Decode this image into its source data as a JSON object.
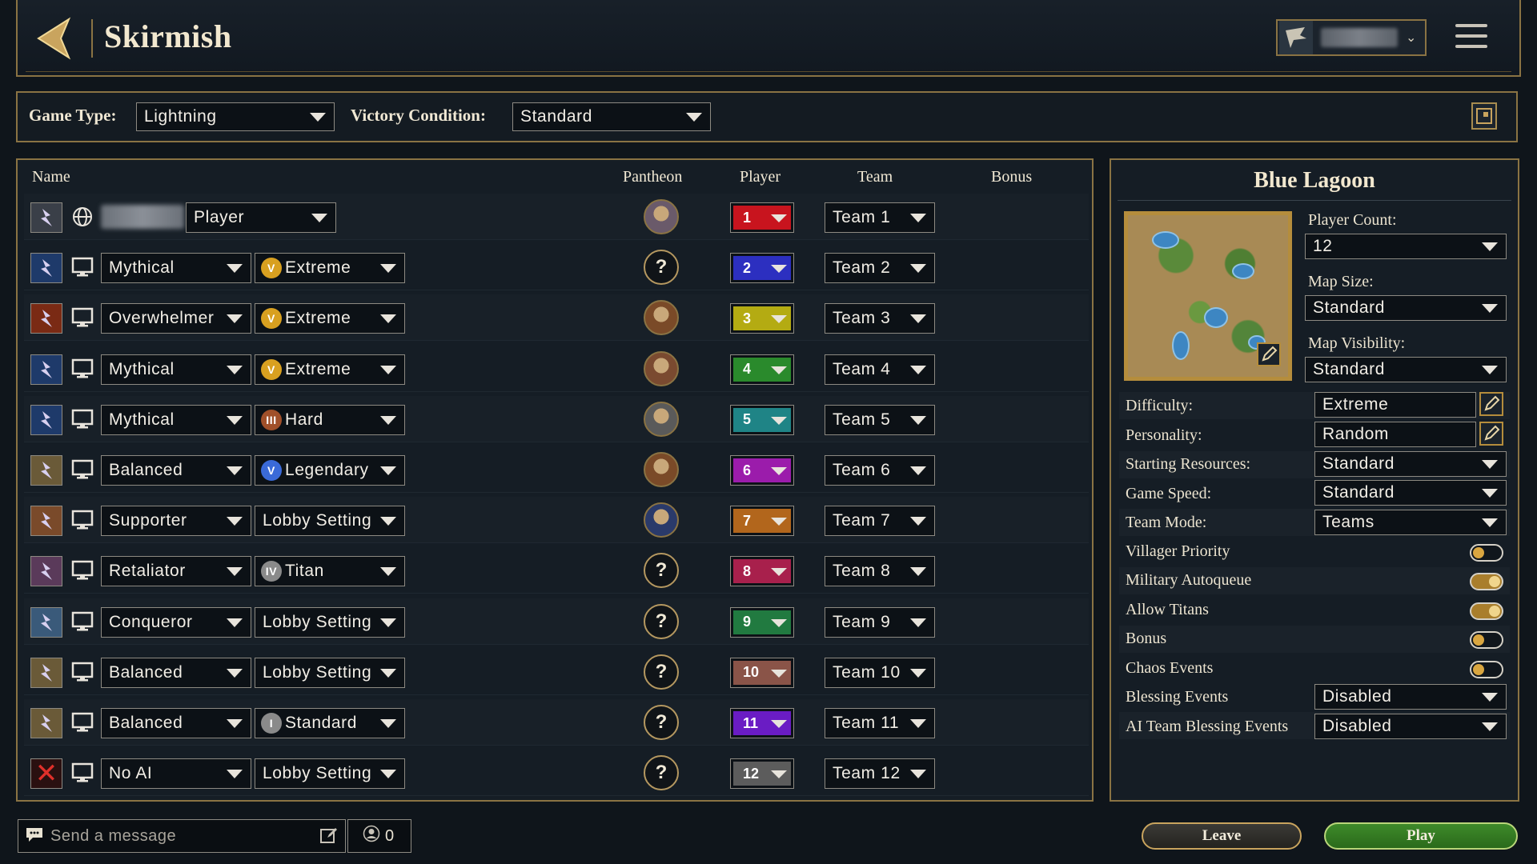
{
  "header": {
    "title": "Skirmish",
    "profile_name": ""
  },
  "filters": {
    "game_type_label": "Game Type:",
    "game_type_value": "Lightning",
    "victory_label": "Victory Condition:",
    "victory_value": "Standard"
  },
  "columns": {
    "name": "Name",
    "pantheon": "Pantheon",
    "player": "Player",
    "team": "Team",
    "bonus": "Bonus"
  },
  "players": [
    {
      "portrait": "human-player-avatar",
      "type_icon": "globe-icon",
      "ai": "Player",
      "difficulty": "",
      "diff_icon": "",
      "pantheon": "known",
      "player_num": "1",
      "color": "#c8141e",
      "team": "Team 1"
    },
    {
      "portrait": "lightning-god-portrait",
      "type_icon": "computer-icon",
      "ai": "Mythical",
      "difficulty": "Extreme",
      "diff_icon": "V",
      "pantheon": "unknown",
      "player_num": "2",
      "color": "#2c2fc0",
      "team": "Team 2"
    },
    {
      "portrait": "fire-warrior-portrait",
      "type_icon": "computer-icon",
      "ai": "Overwhelmer",
      "difficulty": "Extreme",
      "diff_icon": "V",
      "pantheon": "known",
      "player_num": "3",
      "color": "#b4ab12",
      "team": "Team 3"
    },
    {
      "portrait": "lightning-god-portrait",
      "type_icon": "computer-icon",
      "ai": "Mythical",
      "difficulty": "Extreme",
      "diff_icon": "V",
      "pantheon": "known",
      "player_num": "4",
      "color": "#2a8a2c",
      "team": "Team 4"
    },
    {
      "portrait": "lightning-god-portrait",
      "type_icon": "computer-icon",
      "ai": "Mythical",
      "difficulty": "Hard",
      "diff_icon": "III",
      "pantheon": "known",
      "player_num": "5",
      "color": "#1f8486",
      "team": "Team 5"
    },
    {
      "portrait": "scholar-portrait",
      "type_icon": "computer-icon",
      "ai": "Balanced",
      "difficulty": "Legendary",
      "diff_icon": "V",
      "pantheon": "known",
      "player_num": "6",
      "color": "#9b1cab",
      "team": "Team 6"
    },
    {
      "portrait": "handshake-portrait",
      "type_icon": "computer-icon",
      "ai": "Supporter",
      "difficulty": "Lobby Setting",
      "diff_icon": "",
      "pantheon": "known",
      "player_num": "7",
      "color": "#b2661c",
      "team": "Team 7"
    },
    {
      "portrait": "retaliator-portrait",
      "type_icon": "computer-icon",
      "ai": "Retaliator",
      "difficulty": "Titan",
      "diff_icon": "IV",
      "pantheon": "unknown",
      "player_num": "8",
      "color": "#a8204c",
      "team": "Team 8"
    },
    {
      "portrait": "conqueror-portrait",
      "type_icon": "computer-icon",
      "ai": "Conqueror",
      "difficulty": "Lobby Setting",
      "diff_icon": "",
      "pantheon": "unknown",
      "player_num": "9",
      "color": "#217a40",
      "team": "Team 9"
    },
    {
      "portrait": "scholar-portrait",
      "type_icon": "computer-icon",
      "ai": "Balanced",
      "difficulty": "Lobby Setting",
      "diff_icon": "",
      "pantheon": "unknown",
      "player_num": "10",
      "color": "#8a5448",
      "team": "Team 10"
    },
    {
      "portrait": "scholar-portrait",
      "type_icon": "computer-icon",
      "ai": "Balanced",
      "difficulty": "Standard",
      "diff_icon": "I",
      "pantheon": "unknown",
      "player_num": "11",
      "color": "#6a1cc4",
      "team": "Team 11"
    },
    {
      "portrait": "no-ai-x-icon",
      "type_icon": "computer-icon",
      "ai": "No AI",
      "difficulty": "Lobby Setting",
      "diff_icon": "",
      "pantheon": "unknown",
      "player_num": "12",
      "color": "#5c5c5c",
      "team": "Team 12"
    }
  ],
  "map": {
    "name": "Blue Lagoon",
    "player_count_label": "Player Count:",
    "player_count": "12",
    "map_size_label": "Map Size:",
    "map_size": "Standard",
    "visibility_label": "Map Visibility:",
    "visibility": "Standard"
  },
  "settings": {
    "difficulty_label": "Difficulty:",
    "difficulty": "Extreme",
    "personality_label": "Personality:",
    "personality": "Random",
    "resources_label": "Starting Resources:",
    "resources": "Standard",
    "speed_label": "Game Speed:",
    "speed": "Standard",
    "team_mode_label": "Team Mode:",
    "team_mode": "Teams",
    "toggles": [
      {
        "label": "Villager Priority",
        "on": false
      },
      {
        "label": "Military Autoqueue",
        "on": true
      },
      {
        "label": "Allow Titans",
        "on": true
      },
      {
        "label": "Bonus",
        "on": false
      },
      {
        "label": "Chaos Events",
        "on": false
      }
    ],
    "blessing_label": "Blessing Events",
    "blessing": "Disabled",
    "ai_blessing_label": "AI Team Blessing Events",
    "ai_blessing": "Disabled"
  },
  "footer": {
    "chat_placeholder": "Send a message",
    "viewer_count": "0",
    "leave_label": "Leave",
    "play_label": "Play"
  },
  "colors": {
    "accent_gold": "#8a7343",
    "play_green": "#2f7a20"
  }
}
